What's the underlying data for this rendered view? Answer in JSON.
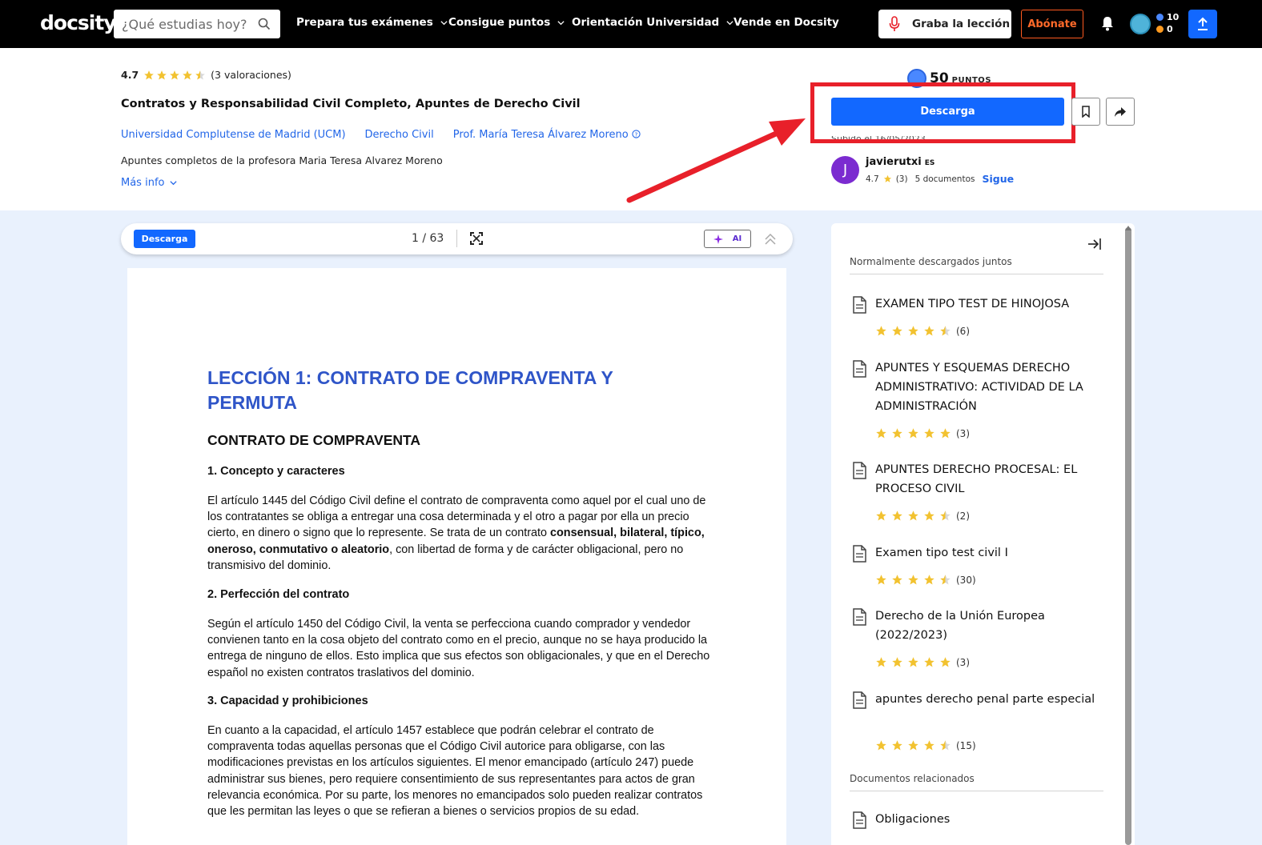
{
  "nav": {
    "logo": "docsity",
    "search_placeholder": "¿Qué estudias hoy?",
    "links": [
      "Prepara tus exámenes",
      "Consigue puntos",
      "Orientación Universidad",
      "Vende en Docsity"
    ],
    "record_label": "Graba la lección",
    "subscribe_label": "Abónate",
    "points_blue": "10",
    "points_orange": "0",
    "colors": {
      "accent": "#1268ff",
      "subscribe": "#ff6a2a",
      "highlight": "#e8202a"
    }
  },
  "doc": {
    "rating": "4.7",
    "rating_count": "(3 valoraciones)",
    "stars_value": 4.5,
    "title": "Contratos y Responsabilidad Civil Completo, Apuntes de Derecho Civil",
    "university": "Universidad Complutense de Madrid (UCM)",
    "subject": "Derecho Civil",
    "professor": "Prof. María Teresa Álvarez Moreno",
    "description": "Apuntes completos de la profesora Maria Teresa Alvarez Moreno",
    "more_info": "Más info",
    "points": "50",
    "points_label": "PUNTOS",
    "download_label": "Descarga",
    "uploaded_text": "Subido el 16/05/2023"
  },
  "uploader": {
    "initial": "J",
    "name": "javierutxi",
    "lang": "ES",
    "rating": "4.7",
    "rating_count": "(3)",
    "documents": "5 documentos",
    "follow": "Sigue"
  },
  "viewer": {
    "download_label": "Descarga",
    "page_indicator": "1 / 63",
    "ai_label": "AI"
  },
  "page_content": {
    "heading": "LECCIÓN 1: CONTRATO DE COMPRAVENTA Y PERMUTA",
    "subheading": "CONTRATO DE COMPRAVENTA",
    "s1": "1. Concepto y caracteres",
    "p1a": "El artículo 1445 del Código Civil define el contrato de compraventa como aquel por el cual uno de los contratantes se obliga a entregar una cosa determinada y el otro a pagar por ella un precio cierto, en dinero o signo que lo represente. Se trata de un contrato ",
    "p1b": "consensual, bilateral, típico, oneroso, conmutativo o aleatorio",
    "p1c": ", con libertad de forma y de carácter obligacional, pero no transmisivo del dominio.",
    "s2": "2. Perfección del contrato",
    "p2": "Según el artículo 1450 del Código Civil, la venta se perfecciona cuando comprador y vendedor convienen tanto en la cosa objeto del contrato como en el precio, aunque no se haya producido la entrega de ninguno de ellos. Esto implica que sus efectos son obligacionales, y que en el Derecho español no existen contratos traslativos del dominio.",
    "s3": "3. Capacidad y prohibiciones",
    "p3": "En cuanto a la capacidad, el artículo 1457 establece que podrán celebrar el contrato de compraventa todas aquellas personas que el Código Civil autorice para obligarse, con las modificaciones previstas en los artículos siguientes. El menor emancipado (artículo 247) puede administrar sus bienes, pero requiere consentimiento de sus representantes para actos de gran relevancia económica. Por su parte, los menores no emancipados solo pueden realizar contratos que les permitan las leyes o que se refieran a bienes o servicios propios de su edad."
  },
  "sidebar": {
    "section1": "Normalmente descargados juntos",
    "section2": "Documentos relacionados",
    "items": [
      {
        "title": "EXAMEN TIPO TEST DE HINOJOSA",
        "count": "(6)",
        "stars": 4.5
      },
      {
        "title": "APUNTES Y ESQUEMAS DERECHO ADMINISTRATIVO: ACTIVIDAD DE LA ADMINISTRACIÓN",
        "count": "(3)",
        "stars": 5
      },
      {
        "title": "APUNTES DERECHO PROCESAL: EL PROCESO CIVIL",
        "count": "(2)",
        "stars": 4.5
      },
      {
        "title": "Examen tipo test civil I",
        "count": "(30)",
        "stars": 4.5
      },
      {
        "title": "Derecho de la Unión Europea (2022/2023)",
        "count": "(3)",
        "stars": 5
      },
      {
        "title": "apuntes derecho penal parte especial",
        "count": "(15)",
        "stars": 4.5
      }
    ],
    "related": [
      {
        "title": "Obligaciones"
      }
    ]
  }
}
